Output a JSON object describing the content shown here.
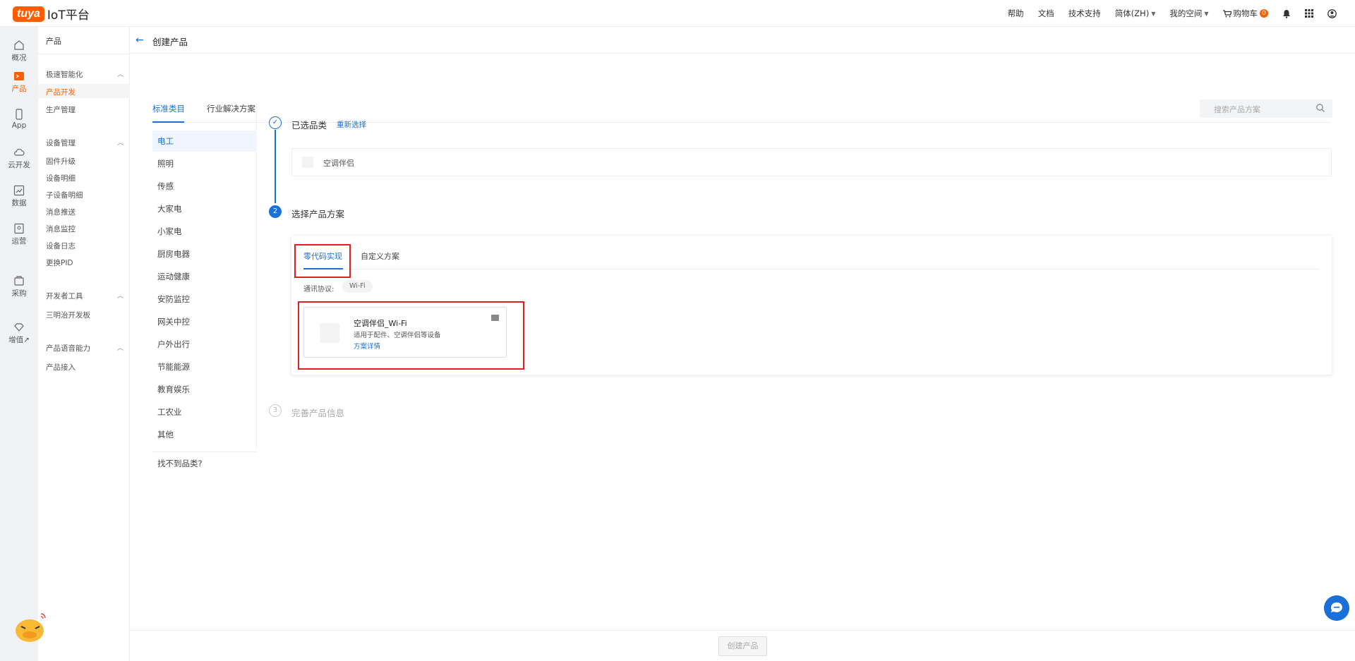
{
  "brand": {
    "logo_mark": "tuya",
    "platform": "IoT平台",
    "accent": "#ff5c00",
    "primary": "#1b6fd9"
  },
  "topnav": {
    "help": "帮助",
    "docs": "文档",
    "support": "技术支持",
    "language": "简体(ZH)",
    "space": "我的空间",
    "cart": "购物车",
    "cart_count": "0",
    "icons": [
      "bell-icon",
      "apps-grid-icon",
      "user-icon"
    ]
  },
  "rail": {
    "items": [
      {
        "label": "概况",
        "icon": "home-icon"
      },
      {
        "label": "产品",
        "icon": "product-icon"
      },
      {
        "label": "App",
        "icon": "phone-icon"
      },
      {
        "label": "云开发",
        "icon": "cloud-icon"
      },
      {
        "label": "数据",
        "icon": "chart-icon"
      },
      {
        "label": "运营",
        "icon": "operate-icon"
      },
      {
        "label": "采购",
        "icon": "purchase-icon"
      },
      {
        "label": "增值↗",
        "icon": "diamond-icon"
      }
    ]
  },
  "sidebar": {
    "title": "产品",
    "groups": [
      {
        "label": "极速智能化",
        "links": [
          "产品开发",
          "生产管理"
        ]
      },
      {
        "label": "设备管理",
        "links": [
          "固件升级",
          "设备明细",
          "子设备明细",
          "消息推送",
          "消息监控",
          "设备日志",
          "更换PID"
        ]
      },
      {
        "label": "开发者工具",
        "links": [
          "三明治开发板"
        ]
      },
      {
        "label": "产品语音能力",
        "links": [
          "产品接入"
        ]
      }
    ]
  },
  "page": {
    "title": "创建产品",
    "tabs": [
      "标准类目",
      "行业解决方案"
    ],
    "search_placeholder": "搜索产品方案",
    "categories": [
      "电工",
      "照明",
      "传感",
      "大家电",
      "小家电",
      "厨房电器",
      "运动健康",
      "安防监控",
      "网关中控",
      "户外出行",
      "节能能源",
      "教育娱乐",
      "工农业",
      "其他"
    ],
    "category_missing": "找不到品类?",
    "steps": {
      "step1": {
        "num": "✓",
        "label": "已选品类",
        "action": "重新选择",
        "selected": "空调伴侣"
      },
      "step2": {
        "num": "2",
        "label": "选择产品方案"
      },
      "step3": {
        "num": "3",
        "label": "完善产品信息"
      }
    },
    "scheme_tabs": [
      "零代码实现",
      "自定义方案"
    ],
    "protocol_label": "通讯协议:",
    "protocol_value": "Wi-Fi",
    "solution": {
      "title": "空调伴侣_Wi-Fi",
      "desc": "适用于配件、空调伴侣等设备",
      "link": "方案详情"
    },
    "create_button": "创建产品"
  }
}
